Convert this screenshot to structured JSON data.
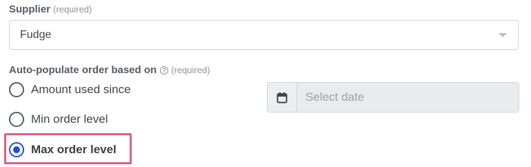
{
  "supplier": {
    "label": "Supplier",
    "required": "(required)",
    "value": "Fudge"
  },
  "autopopulate": {
    "label": "Auto-populate order based on",
    "help_glyph": "?",
    "required": "(required)",
    "options": [
      {
        "label": "Amount used since",
        "checked": false
      },
      {
        "label": "Min order level",
        "checked": false
      },
      {
        "label": "Max order level",
        "checked": true
      }
    ],
    "date_placeholder": "Select date"
  },
  "icons": {
    "select_caret": "chevron-down-icon",
    "date_addon": "calendar-icon",
    "help": "question-circle-icon"
  },
  "colors": {
    "radio_checked": "#1d4ed8",
    "highlight_border": "#d9608a",
    "disabled_input_bg": "#e9ecef"
  }
}
